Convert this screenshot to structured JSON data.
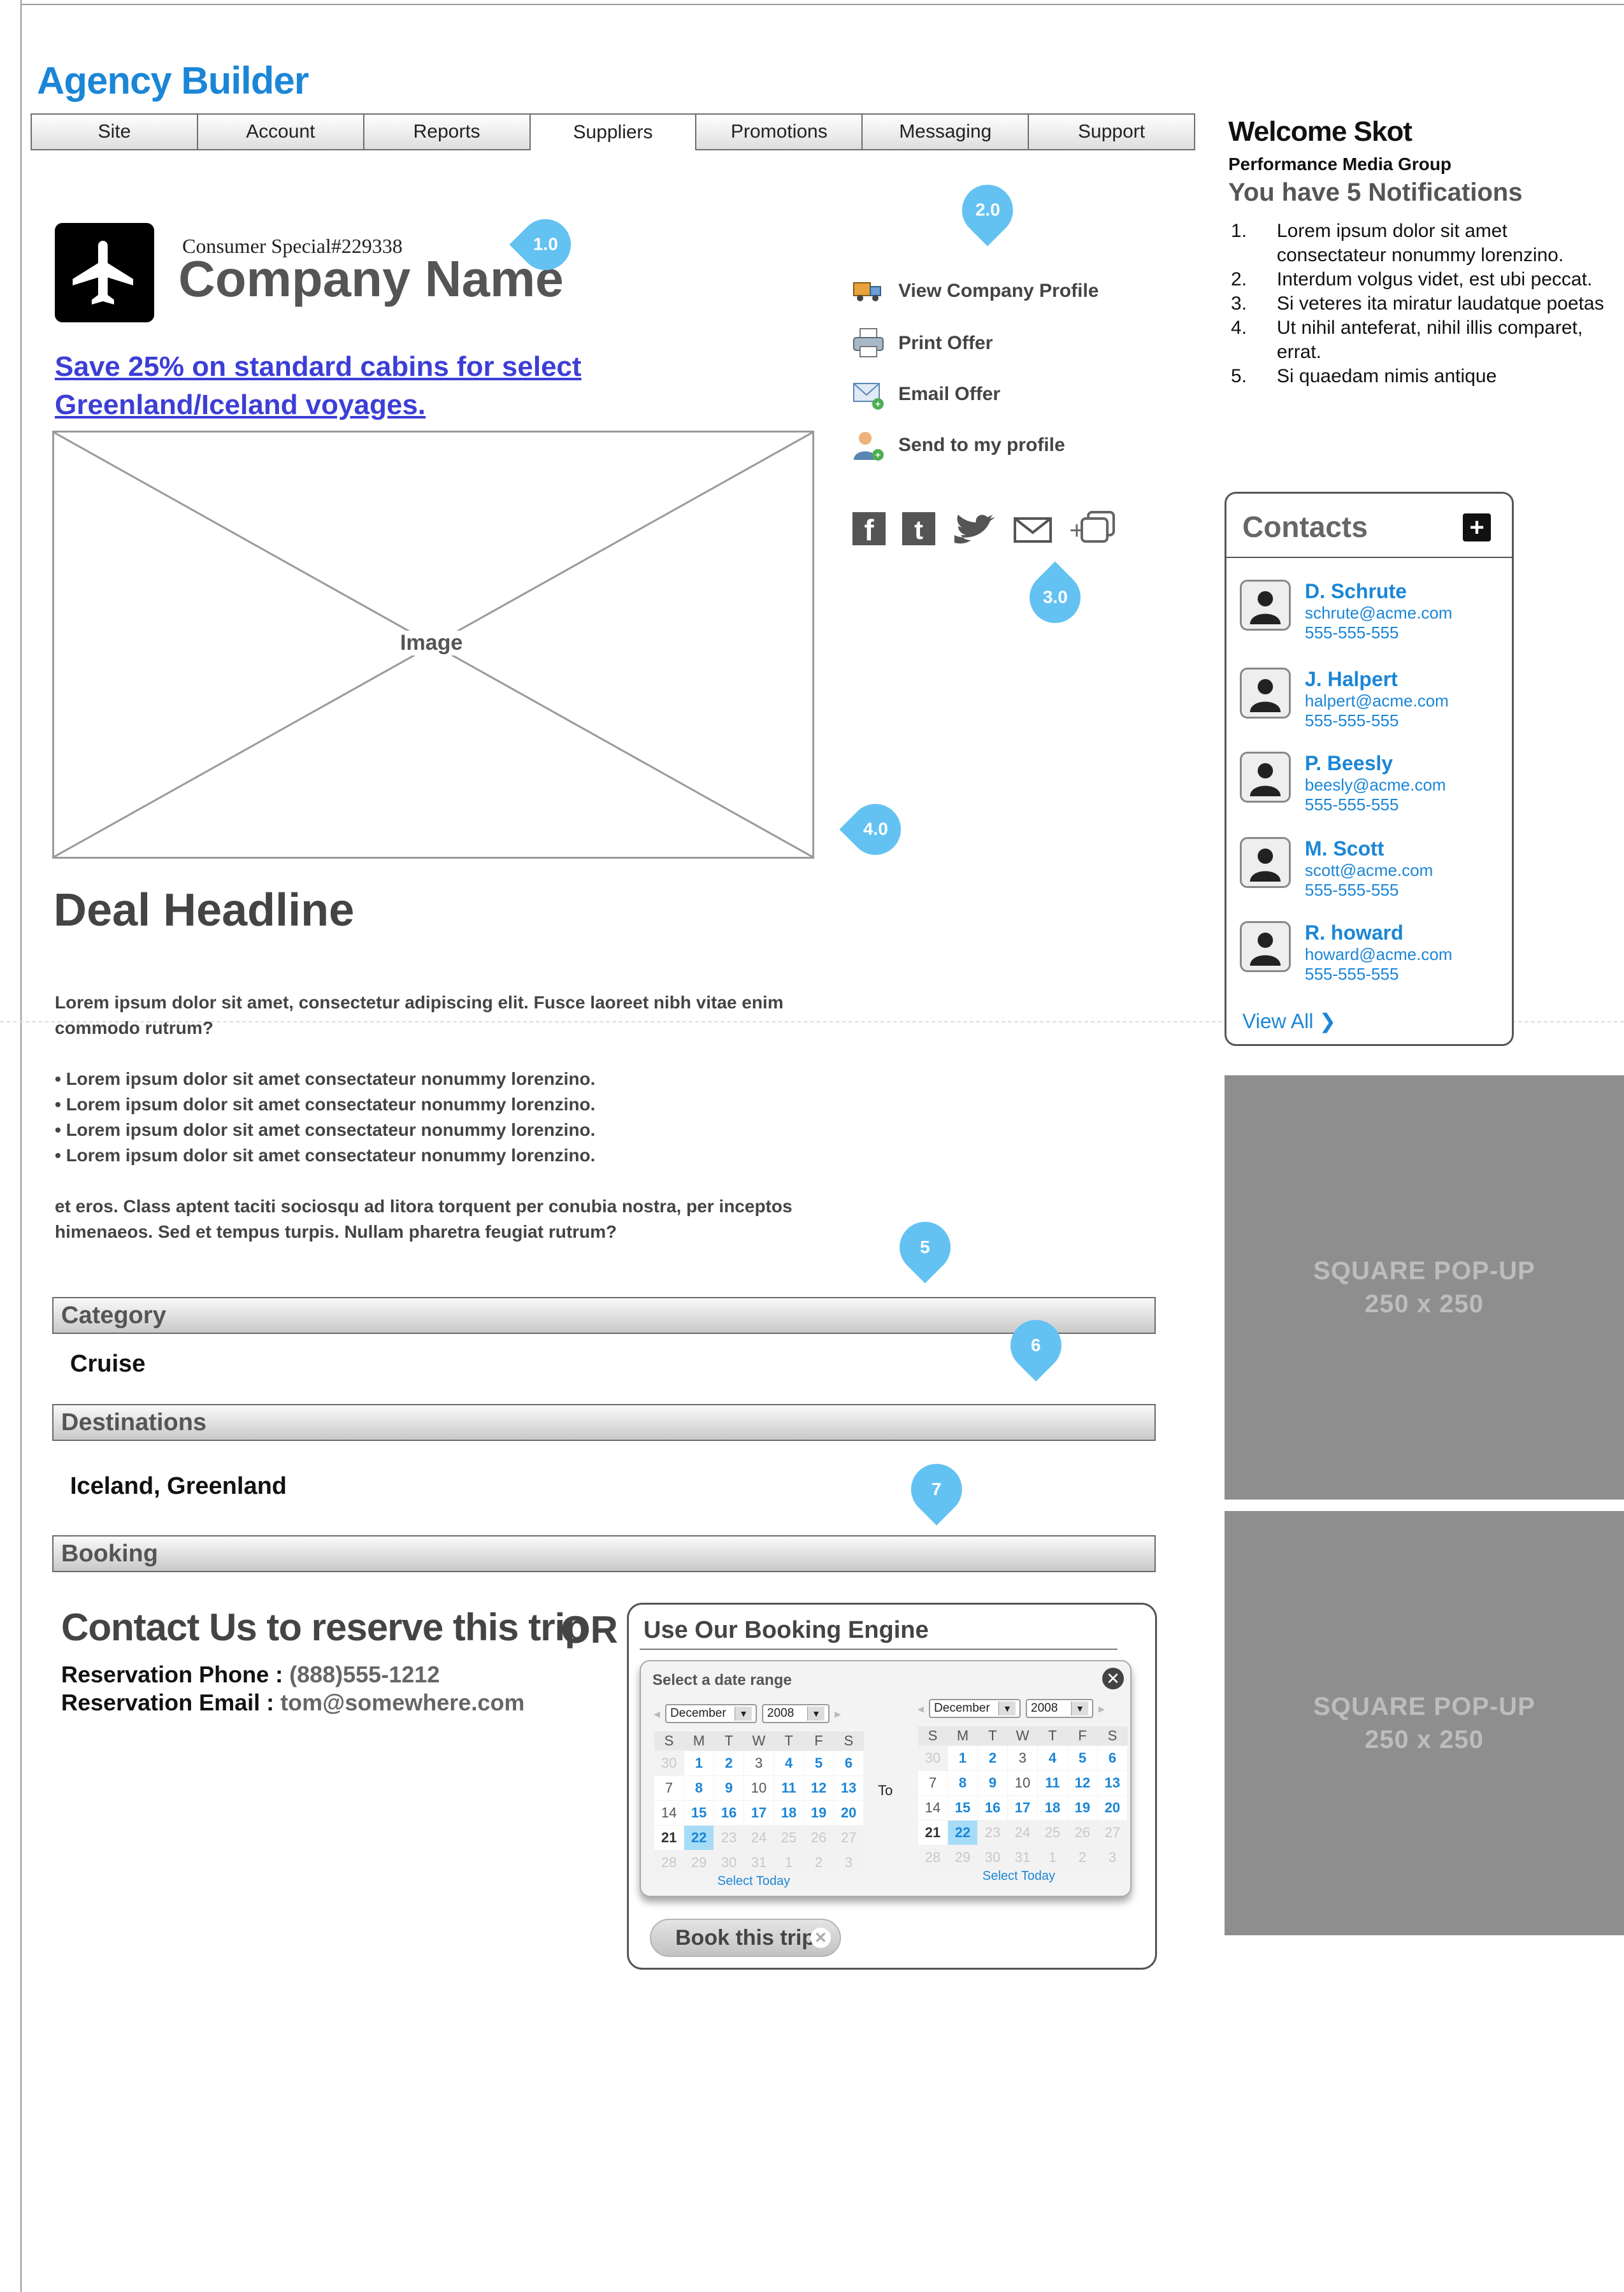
{
  "app": {
    "title": "Agency Builder"
  },
  "nav": {
    "tabs": [
      {
        "label": "Site"
      },
      {
        "label": "Account"
      },
      {
        "label": "Reports"
      },
      {
        "label": "Suppliers",
        "active": true
      },
      {
        "label": "Promotions"
      },
      {
        "label": "Messaging"
      },
      {
        "label": "Support"
      }
    ]
  },
  "offer": {
    "special_id": "Consumer Special#229338",
    "company_name": "Company Name",
    "promo_link": "Save 25% on standard cabins for select Greenland/Iceland voyages.",
    "image_label": "Image",
    "headline": "Deal Headline",
    "intro": "Lorem ipsum dolor sit amet, consectetur adipiscing elit. Fusce laoreet nibh vitae enim commodo rutrum?",
    "bullets": [
      "• Lorem ipsum dolor sit amet consectateur nonummy lorenzino.",
      "• Lorem ipsum dolor sit amet consectateur nonummy lorenzino.",
      "• Lorem ipsum dolor sit amet consectateur nonummy lorenzino.",
      "• Lorem ipsum dolor sit amet consectateur nonummy lorenzino."
    ],
    "outro": "et eros. Class aptent taciti sociosqu ad litora torquent per conubia nostra, per inceptos himenaeos. Sed et tempus turpis. Nullam pharetra feugiat rutrum?"
  },
  "actions": {
    "view_profile": "View Company Profile",
    "print": "Print Offer",
    "email": "Email Offer",
    "send_profile": "Send to my profile"
  },
  "markers": {
    "m1": "1.0",
    "m2": "2.0",
    "m3": "3.0",
    "m4": "4.0",
    "m5": "5",
    "m6": "6",
    "m7": "7"
  },
  "sections": {
    "category_label": "Category",
    "category_value": "Cruise",
    "destinations_label": "Destinations",
    "destinations_value": "Iceland, Greenland",
    "booking_label": "Booking"
  },
  "booking": {
    "contact_heading": "Contact Us to reserve this trip",
    "or": "OR",
    "phone_label": "Reservation Phone : ",
    "phone_value": "(888)555-1212",
    "email_label": "Reservation Email : ",
    "email_value": "tom@somewhere.com",
    "engine_title": "Use Our Booking Engine",
    "picker_title": "Select a date range",
    "to_label": "To",
    "select_today": "Select Today",
    "book_button": "Book this trip",
    "calendar": {
      "month": "December",
      "year": "2008",
      "weekdays": [
        "S",
        "M",
        "T",
        "W",
        "T",
        "F",
        "S"
      ],
      "rows": [
        [
          "30",
          "1",
          "2",
          "3",
          "4",
          "5",
          "6"
        ],
        [
          "7",
          "8",
          "9",
          "10",
          "11",
          "12",
          "13"
        ],
        [
          "14",
          "15",
          "16",
          "17",
          "18",
          "19",
          "20"
        ],
        [
          "21",
          "22",
          "23",
          "24",
          "25",
          "26",
          "27"
        ],
        [
          "28",
          "29",
          "30",
          "31",
          "1",
          "2",
          "3"
        ]
      ]
    }
  },
  "sidebar": {
    "welcome": "Welcome Skot",
    "org": "Performance Media Group",
    "notif_count": "You have 5 Notifications",
    "notifications": [
      {
        "n": "1.",
        "text": "Lorem ipsum dolor sit amet consectateur nonummy lorenzino."
      },
      {
        "n": "2.",
        "text": "Interdum volgus videt, est ubi peccat."
      },
      {
        "n": "3.",
        "text": "Si veteres ita miratur laudatque poetas"
      },
      {
        "n": "4.",
        "text": "Ut nihil anteferat, nihil illis comparet, errat."
      },
      {
        "n": "5.",
        "text": "Si quaedam nimis antique"
      }
    ],
    "contacts_title": "Contacts",
    "contacts": [
      {
        "name": "D. Schrute",
        "email": "schrute@acme.com",
        "phone": "555-555-555"
      },
      {
        "name": "J. Halpert",
        "email": "halpert@acme.com",
        "phone": "555-555-555"
      },
      {
        "name": "P. Beesly",
        "email": "beesly@acme.com",
        "phone": "555-555-555"
      },
      {
        "name": "M. Scott",
        "email": "scott@acme.com",
        "phone": "555-555-555"
      },
      {
        "name": "R. howard",
        "email": "howard@acme.com",
        "phone": "555-555-555"
      }
    ],
    "view_all": "View All ❯",
    "ad1_line1": "SQUARE POP-UP",
    "ad1_line2": "250 x 250",
    "ad2_line1": "SQUARE POP-UP",
    "ad2_line2": "250 x 250"
  },
  "colors": {
    "accent": "#1b86d6",
    "marker": "#63c2f1",
    "link": "#3c3ed6",
    "ad": "#8e8e8e"
  }
}
